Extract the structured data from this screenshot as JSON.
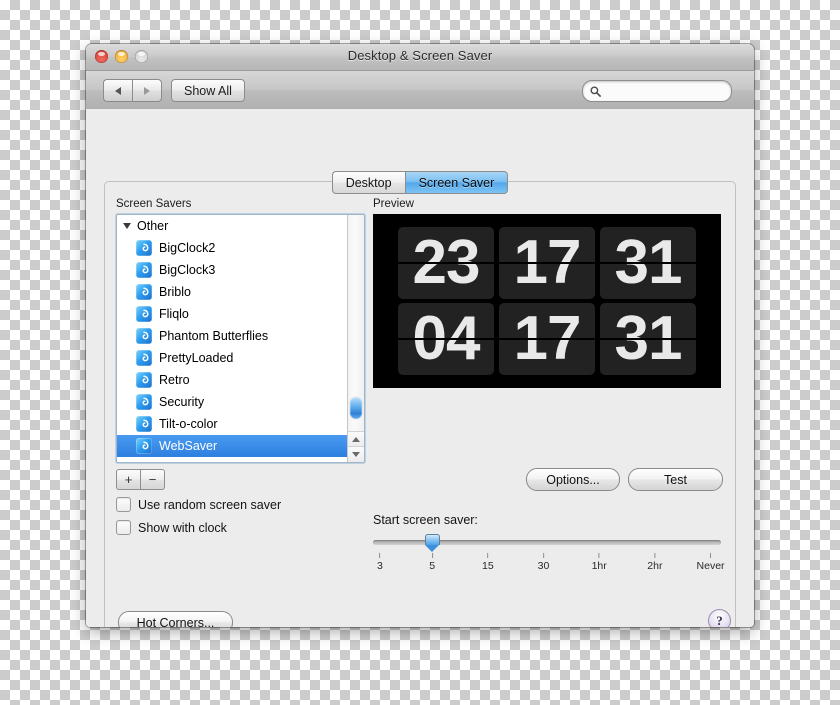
{
  "window": {
    "title": "Desktop & Screen Saver",
    "traffic_lights": [
      {
        "name": "close",
        "color": "#da4a3d"
      },
      {
        "name": "minimize",
        "color": "#f3b33f"
      },
      {
        "name": "zoom",
        "color": "#d6d6d6"
      }
    ]
  },
  "toolbar": {
    "back_icon": "triangle-left-icon",
    "forward_icon": "triangle-right-icon",
    "show_all_label": "Show All",
    "search": {
      "icon": "search-icon",
      "value": "",
      "placeholder": ""
    }
  },
  "tabs": [
    {
      "label": "Desktop",
      "active": false
    },
    {
      "label": "Screen Saver",
      "active": true
    }
  ],
  "left_pane": {
    "label": "Screen Savers",
    "group": {
      "label": "Other",
      "expanded": true,
      "disclosure_icon": "triangle-down-icon"
    },
    "items": [
      {
        "label": "BigClock2",
        "selected": false
      },
      {
        "label": "BigClock3",
        "selected": false
      },
      {
        "label": "Briblo",
        "selected": false
      },
      {
        "label": "Fliqlo",
        "selected": false
      },
      {
        "label": "Phantom Butterflies",
        "selected": false
      },
      {
        "label": "PrettyLoaded",
        "selected": false
      },
      {
        "label": "Retro",
        "selected": false
      },
      {
        "label": "Security",
        "selected": false
      },
      {
        "label": "Tilt-o-color",
        "selected": false
      },
      {
        "label": "WebSaver",
        "selected": true
      }
    ],
    "add_button_label": "+",
    "remove_button_label": "−",
    "checkboxes": [
      {
        "label": "Use random screen saver",
        "checked": false
      },
      {
        "label": "Show with clock",
        "checked": false
      }
    ]
  },
  "preview": {
    "label": "Preview",
    "background_color": "#000000",
    "clock_tiles": [
      [
        "23",
        "17",
        "31"
      ],
      [
        "04",
        "17",
        "31"
      ]
    ]
  },
  "actions": {
    "options_label": "Options...",
    "test_label": "Test",
    "hot_corners_label": "Hot Corners...",
    "help_label": "?"
  },
  "slider": {
    "label": "Start screen saver:",
    "value": "5",
    "value_position_percent": 17,
    "ticks": [
      {
        "label": "3",
        "position_percent": 2
      },
      {
        "label": "5",
        "position_percent": 17
      },
      {
        "label": "15",
        "position_percent": 33
      },
      {
        "label": "30",
        "position_percent": 49
      },
      {
        "label": "1hr",
        "position_percent": 65
      },
      {
        "label": "2hr",
        "position_percent": 81
      },
      {
        "label": "Never",
        "position_percent": 97
      }
    ]
  },
  "colors": {
    "accent_blue": "#2c7fe0",
    "tab_active": "#54a8ea",
    "window_bg": "#ececec"
  }
}
